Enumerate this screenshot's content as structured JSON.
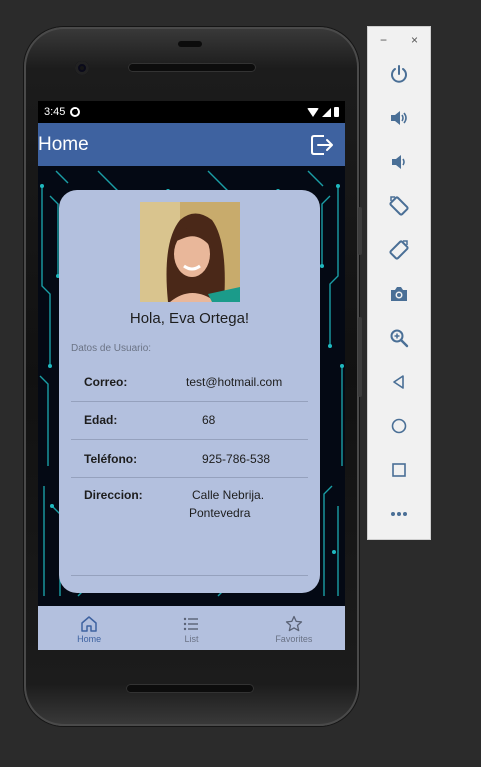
{
  "status_bar": {
    "time": "3:45"
  },
  "app_bar": {
    "title": "Home"
  },
  "profile": {
    "greeting": "Hola, Eva Ortega!",
    "section_label": "Datos de Usuario:",
    "fields": [
      {
        "label": "Correo:",
        "value": "test@hotmail.com"
      },
      {
        "label": "Edad:",
        "value": "68"
      },
      {
        "label": "Teléfono:",
        "value": "925-786-538"
      },
      {
        "label": "Direccion:",
        "value_line1": "Calle Nebrija.",
        "value_line2": "Pontevedra"
      }
    ]
  },
  "bottom_nav": {
    "items": [
      {
        "label": "Home",
        "icon": "home-icon",
        "active": true
      },
      {
        "label": "List",
        "icon": "list-icon",
        "active": false
      },
      {
        "label": "Favorites",
        "icon": "star-icon",
        "active": false
      }
    ]
  },
  "emulator_toolbar": {
    "window_controls": [
      "−",
      "×"
    ],
    "buttons": [
      "power-icon",
      "volume-up-icon",
      "volume-down-icon",
      "rotate-left-icon",
      "rotate-right-icon",
      "camera-icon",
      "zoom-icon",
      "back-icon",
      "home-circle-icon",
      "overview-icon",
      "more-icon"
    ]
  },
  "colors": {
    "app_bar": "#3e62a0",
    "card": "#b3c0de",
    "circuit": "#22c7c7",
    "emulator_icon": "#4a6f96"
  }
}
